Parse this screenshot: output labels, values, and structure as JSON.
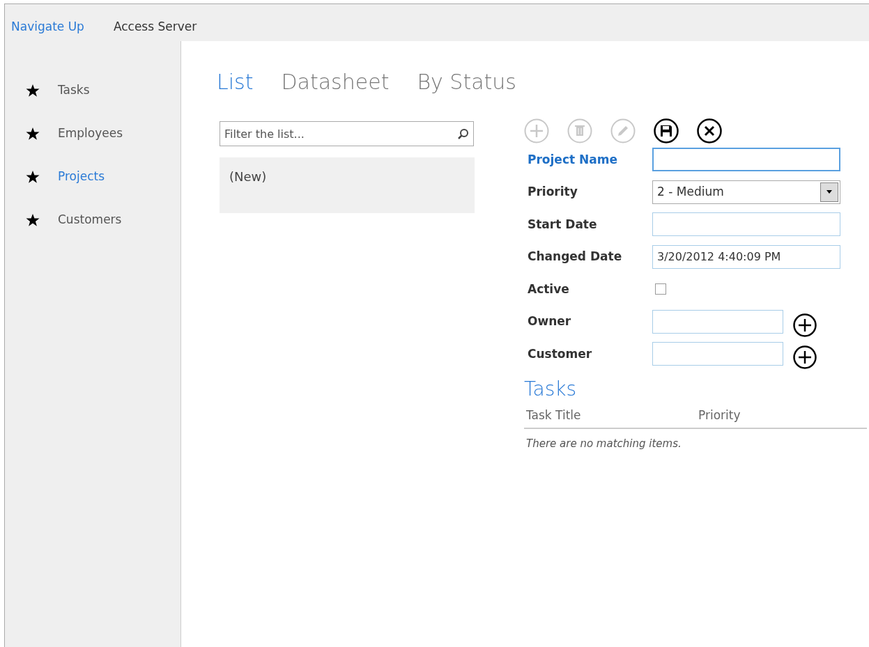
{
  "top_bar": {
    "items": [
      {
        "label": "Navigate Up",
        "kind": "link"
      },
      {
        "label": "Access Server",
        "kind": "title"
      }
    ]
  },
  "sidebar": {
    "items": [
      {
        "label": "Tasks",
        "selected": false
      },
      {
        "label": "Employees",
        "selected": false
      },
      {
        "label": "Projects",
        "selected": true
      },
      {
        "label": "Customers",
        "selected": false
      }
    ]
  },
  "tabs": [
    {
      "label": "List",
      "selected": true
    },
    {
      "label": "Datasheet",
      "selected": false
    },
    {
      "label": "By Status",
      "selected": false
    }
  ],
  "list": {
    "filter": {
      "placeholder": "Filter the list..."
    },
    "items": [
      {
        "label": "(New)",
        "selected": true
      }
    ]
  },
  "toolbar": [
    {
      "kind": "add",
      "disabled": true
    },
    {
      "kind": "delete",
      "disabled": true
    },
    {
      "kind": "edit",
      "disabled": true
    },
    {
      "kind": "save",
      "disabled": false
    },
    {
      "kind": "cancel",
      "disabled": false
    }
  ],
  "form": {
    "fields": [
      {
        "label": "Project Name",
        "kind": "text",
        "focused": true
      },
      {
        "label": "Priority",
        "kind": "select",
        "focused": false,
        "value": "2 - Medium"
      },
      {
        "label": "Start Date",
        "kind": "text",
        "focused": false
      },
      {
        "label": "Changed Date",
        "kind": "text",
        "focused": false,
        "value": "3/20/2012 4:40:09 PM"
      },
      {
        "label": "Active",
        "kind": "checkbox",
        "focused": false,
        "checked": false
      },
      {
        "label": "Owner",
        "kind": "lookup",
        "focused": false
      },
      {
        "label": "Customer",
        "kind": "lookup",
        "focused": false
      }
    ]
  },
  "related": {
    "title": "Tasks",
    "columns": [
      "Task Title",
      "Priority"
    ],
    "empty_message": "There are no matching items."
  }
}
